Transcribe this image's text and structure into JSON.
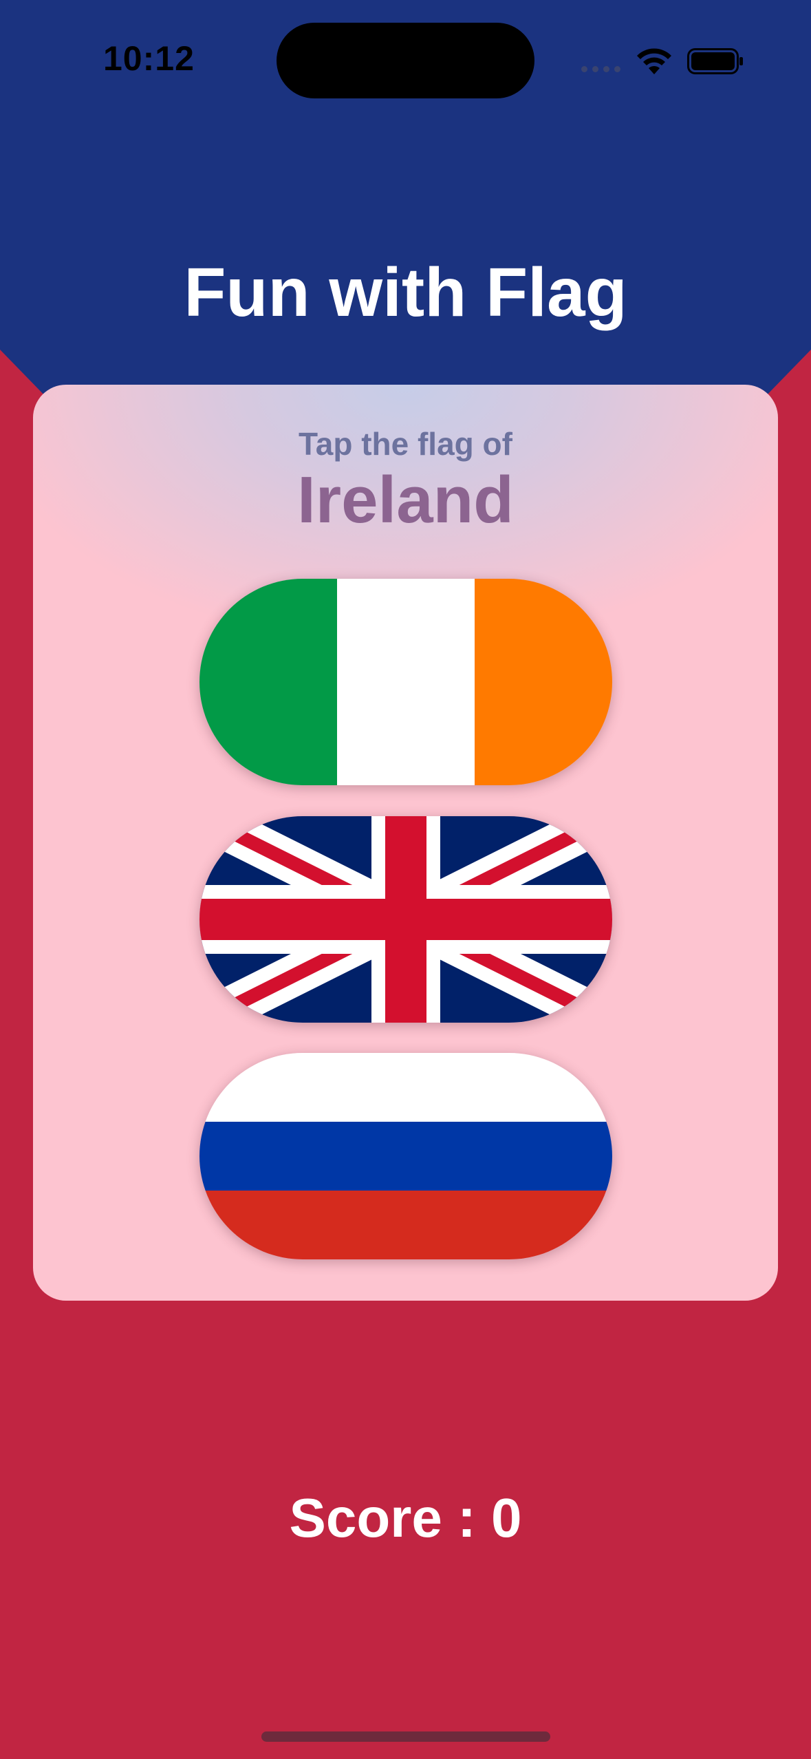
{
  "status_bar": {
    "time": "10:12",
    "icons": [
      "cellular-signal-icon",
      "wifi-icon",
      "battery-icon"
    ]
  },
  "title": "Fun with Flag",
  "prompt": {
    "label": "Tap the flag of",
    "country": "Ireland"
  },
  "flags": [
    {
      "name": "ireland-flag",
      "colors": [
        "#029A47",
        "#FFFFFF",
        "#FF7A00"
      ]
    },
    {
      "name": "united-kingdom-flag",
      "colors": [
        "#012169",
        "#FFFFFF",
        "#D3102E"
      ]
    },
    {
      "name": "russia-flag",
      "colors": [
        "#FFFFFF",
        "#0037A6",
        "#D52B1E"
      ]
    }
  ],
  "score": {
    "text": "Score : 0"
  },
  "colors": {
    "header_blue": "#1B3380",
    "background_red": "#C12542",
    "title_white": "#FFFFFF"
  }
}
